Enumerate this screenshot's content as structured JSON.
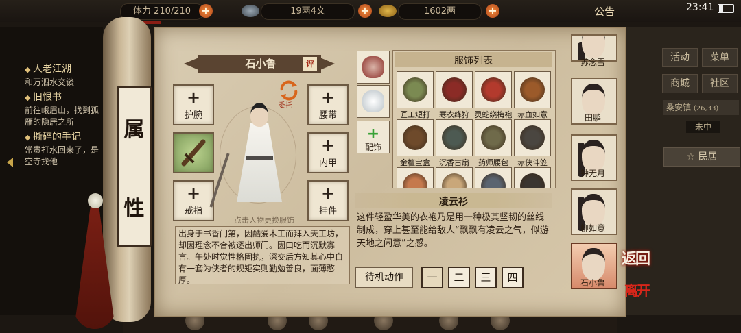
{
  "status_bar": {
    "stamina_label": "体力",
    "stamina_value": "210/210",
    "money_text": "19两4文",
    "gold_text": "1602两",
    "notice_label": "公告",
    "time": "23:41"
  },
  "quests": [
    {
      "title": "人老江湖",
      "desc": "和万泗水交谈"
    },
    {
      "title": "旧恨书",
      "desc": "前往峨眉山，找到孤雁的隐居之所"
    },
    {
      "title": "撕碎的手记",
      "desc": "常贵打水回来了，是空寺找他"
    }
  ],
  "right_menu": {
    "buttons": [
      "活动",
      "菜单",
      "商城",
      "社区"
    ],
    "location": "桑安镇",
    "coords": "(26,33)",
    "weather": "未中",
    "place": "民居"
  },
  "scroll_label": [
    "属",
    "性"
  ],
  "character": {
    "name": "石小鲁",
    "rate_label": "评",
    "entrust_label": "委托",
    "hint": "点击人物更换服饰",
    "bio": "出身于书香门第，因酷爱木工而拜入天工坊，却因理念不合被逐出师门。因口吃而沉默寡言。午处时觉性格固执，深交后方知其心中自有一套为侠者的规矩实则勤勉善良，面薄憨厚。"
  },
  "equip_slots": [
    {
      "label": "护腕",
      "plus": "+"
    },
    {
      "label": "腰带",
      "plus": "+"
    },
    {
      "label": "",
      "plus": ""
    },
    {
      "label": "内甲",
      "plus": "+"
    },
    {
      "label": "戒指",
      "plus": "+"
    },
    {
      "label": "挂件",
      "plus": "+"
    }
  ],
  "costume_list": {
    "title": "服饰列表",
    "items": [
      {
        "name": "匠工短打",
        "color": "#7b8a52"
      },
      {
        "name": "寒衣绛狩",
        "color": "#8b2b26"
      },
      {
        "name": "灵蛇绕梅袍",
        "color": "#b33a2d"
      },
      {
        "name": "赤血如意",
        "color": "#9b5a2a"
      },
      {
        "name": "金檀宝盒",
        "color": "#6e4a2b"
      },
      {
        "name": "沉香古扇",
        "color": "#4d5a52"
      },
      {
        "name": "药师腰包",
        "color": "#6f6a4a"
      },
      {
        "name": "赤侠斗笠",
        "color": "#4a4640"
      },
      {
        "name": "",
        "color": "#c5794d"
      },
      {
        "name": "",
        "color": "#c9a77a"
      },
      {
        "name": "",
        "color": "#5a6470"
      },
      {
        "name": "",
        "color": "#3a3530"
      }
    ],
    "side_label": "配饰",
    "side_plus": "+"
  },
  "selected_costume": {
    "name": "凌云衫",
    "desc": "这件轻盈华美的衣袍乃是用一种极其坚韧的丝线制成，穿上甚至能给敌人“飘飘有凌云之气，似游天地之闲意”之感。"
  },
  "idle": {
    "label": "待机动作",
    "poses": [
      "一",
      "二",
      "三",
      "四"
    ]
  },
  "roster": [
    "苏念雪",
    "田鹏",
    "钟无月",
    "柳如意",
    "石小鲁"
  ],
  "actions": {
    "back": "返回",
    "leave": "离开"
  }
}
